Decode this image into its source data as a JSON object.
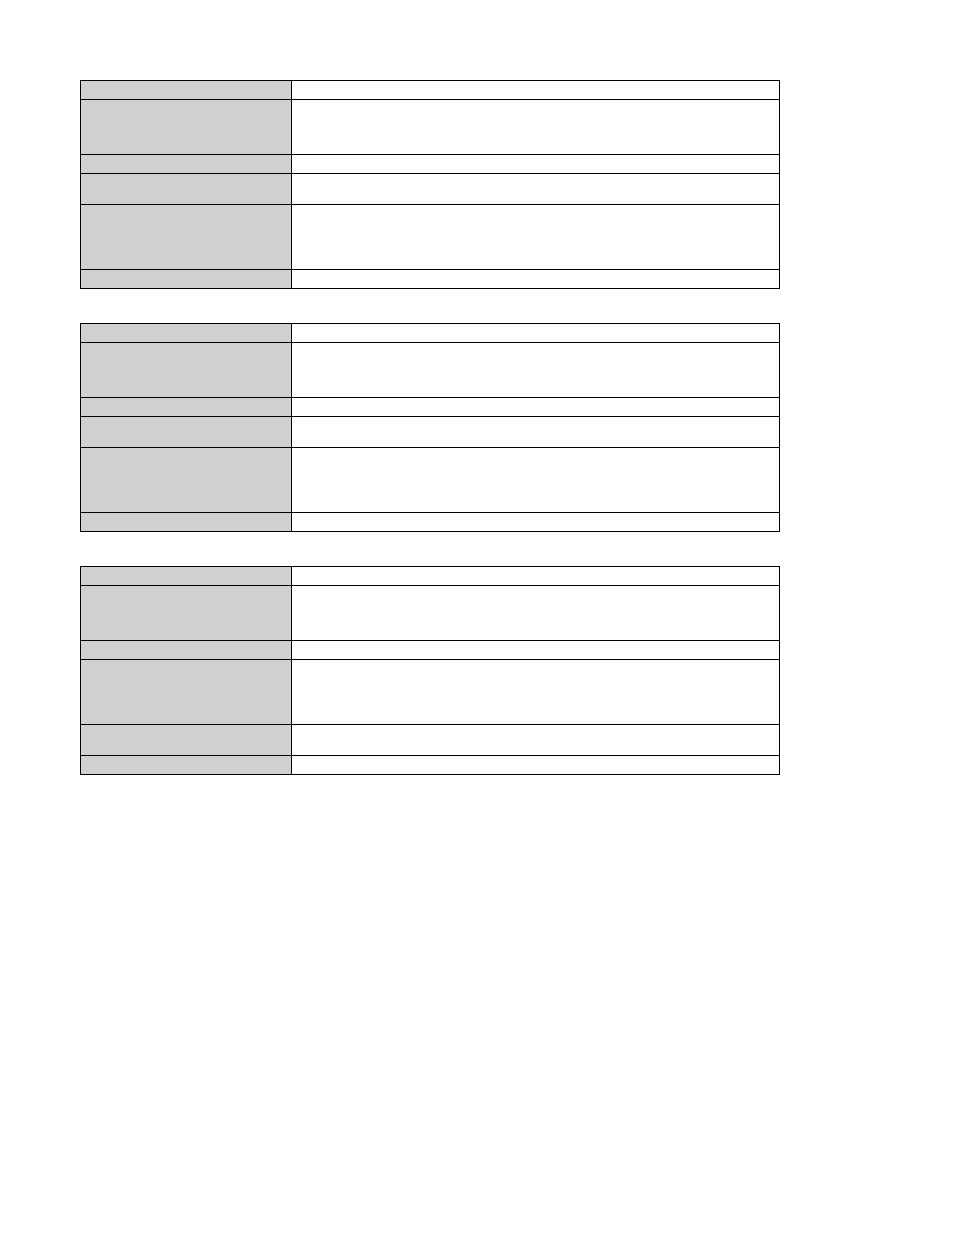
{
  "tables": [
    {
      "rows": [
        {
          "label": "",
          "value": "",
          "h": "h-short"
        },
        {
          "label": "",
          "value": "",
          "h": "h-tall"
        },
        {
          "label": "",
          "value": "",
          "h": "h-short"
        },
        {
          "label": "",
          "value": "",
          "h": "h-med"
        },
        {
          "label": "",
          "value": "",
          "h": "h-tall2"
        },
        {
          "label": "",
          "value": "",
          "h": "h-short"
        }
      ]
    },
    {
      "rows": [
        {
          "label": "",
          "value": "",
          "h": "h-short"
        },
        {
          "label": "",
          "value": "",
          "h": "h-tall"
        },
        {
          "label": "",
          "value": "",
          "h": "h-short"
        },
        {
          "label": "",
          "value": "",
          "h": "h-med"
        },
        {
          "label": "",
          "value": "",
          "h": "h-tall2"
        },
        {
          "label": "",
          "value": "",
          "h": "h-short"
        }
      ]
    },
    {
      "rows": [
        {
          "label": "",
          "value": "",
          "h": "h-short"
        },
        {
          "label": "",
          "value": "",
          "h": "h-tall"
        },
        {
          "label": "",
          "value": "",
          "h": "h-short"
        },
        {
          "label": "",
          "value": "",
          "h": "h-tall2"
        },
        {
          "label": "",
          "value": "",
          "h": "h-med"
        },
        {
          "label": "",
          "value": "",
          "h": "h-short"
        }
      ]
    }
  ]
}
